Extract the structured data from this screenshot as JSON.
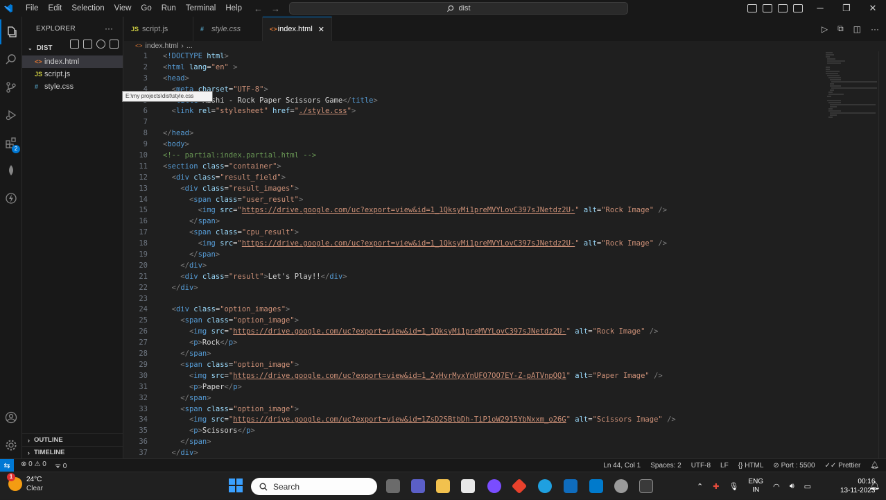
{
  "menu": [
    "File",
    "Edit",
    "Selection",
    "View",
    "Go",
    "Run",
    "Terminal",
    "Help"
  ],
  "command_center": "dist",
  "explorer": {
    "title": "EXPLORER",
    "folder": "DIST",
    "files": [
      {
        "name": "index.html",
        "type": "html"
      },
      {
        "name": "script.js",
        "type": "js"
      },
      {
        "name": "style.css",
        "type": "css"
      }
    ],
    "outline": "OUTLINE",
    "timeline": "TIMELINE"
  },
  "tooltip": "E:\\my projects\\dist\\style.css",
  "tabs": [
    {
      "label": "script.js",
      "icon": "JS",
      "active": false
    },
    {
      "label": "style.css",
      "icon": "#",
      "active": false
    },
    {
      "label": "index.html",
      "icon": "<>",
      "active": true
    }
  ],
  "breadcrumb": {
    "file": "index.html",
    "rest": "..."
  },
  "code_lines": [
    {
      "n": "1",
      "html": "<span class='br'>&lt;</span><span class='kw'>!DOCTYPE</span> <span class='at'>html</span><span class='br'>&gt;</span>"
    },
    {
      "n": "2",
      "html": "<span class='br'>&lt;</span><span class='kw'>html</span> <span class='at'>lang</span>=<span class='st'>\"en\"</span> <span class='br'>&gt;</span>"
    },
    {
      "n": "3",
      "html": "<span class='br'>&lt;</span><span class='kw'>head</span><span class='br'>&gt;</span>"
    },
    {
      "n": "4",
      "html": "  <span class='br'>&lt;</span><span class='kw'>meta</span> <span class='at'>charset</span>=<span class='st'>\"UTF-8\"</span><span class='br'>&gt;</span>"
    },
    {
      "n": "5",
      "html": "  <span class='br'>&lt;</span><span class='kw'>title</span><span class='br'>&gt;</span><span class='tx'>Rishi - Rock Paper Scissors Game</span><span class='br'>&lt;/</span><span class='kw'>title</span><span class='br'>&gt;</span>"
    },
    {
      "n": "6",
      "html": "  <span class='br'>&lt;</span><span class='kw'>link</span> <span class='at'>rel</span>=<span class='st'>\"stylesheet\"</span> <span class='at'>href</span>=<span class='st'>\"<span class='u'>./style.css</span>\"</span><span class='br'>&gt;</span>"
    },
    {
      "n": "7",
      "html": ""
    },
    {
      "n": "8",
      "html": "<span class='br'>&lt;/</span><span class='kw'>head</span><span class='br'>&gt;</span>"
    },
    {
      "n": "9",
      "html": "<span class='br'>&lt;</span><span class='kw'>body</span><span class='br'>&gt;</span>"
    },
    {
      "n": "10",
      "html": "<span class='cm'>&lt;!-- partial:index.partial.html --&gt;</span>"
    },
    {
      "n": "11",
      "html": "<span class='br'>&lt;</span><span class='kw'>section</span> <span class='at'>class</span>=<span class='st'>\"container\"</span><span class='br'>&gt;</span>"
    },
    {
      "n": "12",
      "html": "  <span class='br'>&lt;</span><span class='kw'>div</span> <span class='at'>class</span>=<span class='st'>\"result_field\"</span><span class='br'>&gt;</span>"
    },
    {
      "n": "13",
      "html": "    <span class='br'>&lt;</span><span class='kw'>div</span> <span class='at'>class</span>=<span class='st'>\"result_images\"</span><span class='br'>&gt;</span>"
    },
    {
      "n": "14",
      "html": "      <span class='br'>&lt;</span><span class='kw'>span</span> <span class='at'>class</span>=<span class='st'>\"user_result\"</span><span class='br'>&gt;</span>"
    },
    {
      "n": "15",
      "html": "        <span class='br'>&lt;</span><span class='kw'>img</span> <span class='at'>src</span>=<span class='st'>\"<span class='u'>https://drive.google.com/uc?export=view&amp;id=1_1QksyMi1preMVYLovC397sJNetdz2U-</span>\"</span> <span class='at'>alt</span>=<span class='st'>\"Rock Image\"</span> <span class='br'>/&gt;</span>"
    },
    {
      "n": "16",
      "html": "      <span class='br'>&lt;/</span><span class='kw'>span</span><span class='br'>&gt;</span>"
    },
    {
      "n": "17",
      "html": "      <span class='br'>&lt;</span><span class='kw'>span</span> <span class='at'>class</span>=<span class='st'>\"cpu_result\"</span><span class='br'>&gt;</span>"
    },
    {
      "n": "18",
      "html": "        <span class='br'>&lt;</span><span class='kw'>img</span> <span class='at'>src</span>=<span class='st'>\"<span class='u'>https://drive.google.com/uc?export=view&amp;id=1_1QksyMi1preMVYLovC397sJNetdz2U-</span>\"</span> <span class='at'>alt</span>=<span class='st'>\"Rock Image\"</span> <span class='br'>/&gt;</span>"
    },
    {
      "n": "19",
      "html": "      <span class='br'>&lt;/</span><span class='kw'>span</span><span class='br'>&gt;</span>"
    },
    {
      "n": "20",
      "html": "    <span class='br'>&lt;/</span><span class='kw'>div</span><span class='br'>&gt;</span>"
    },
    {
      "n": "21",
      "html": "    <span class='br'>&lt;</span><span class='kw'>div</span> <span class='at'>class</span>=<span class='st'>\"result\"</span><span class='br'>&gt;</span><span class='tx'>Let's Play!!</span><span class='br'>&lt;/</span><span class='kw'>div</span><span class='br'>&gt;</span>"
    },
    {
      "n": "22",
      "html": "  <span class='br'>&lt;/</span><span class='kw'>div</span><span class='br'>&gt;</span>"
    },
    {
      "n": "23",
      "html": ""
    },
    {
      "n": "24",
      "html": "  <span class='br'>&lt;</span><span class='kw'>div</span> <span class='at'>class</span>=<span class='st'>\"option_images\"</span><span class='br'>&gt;</span>"
    },
    {
      "n": "25",
      "html": "    <span class='br'>&lt;</span><span class='kw'>span</span> <span class='at'>class</span>=<span class='st'>\"option_image\"</span><span class='br'>&gt;</span>"
    },
    {
      "n": "26",
      "html": "      <span class='br'>&lt;</span><span class='kw'>img</span> <span class='at'>src</span>=<span class='st'>\"<span class='u'>https://drive.google.com/uc?export=view&amp;id=1_1QksyMi1preMVYLovC397sJNetdz2U-</span>\"</span> <span class='at'>alt</span>=<span class='st'>\"Rock Image\"</span> <span class='br'>/&gt;</span>"
    },
    {
      "n": "27",
      "html": "      <span class='br'>&lt;</span><span class='kw'>p</span><span class='br'>&gt;</span><span class='tx'>Rock</span><span class='br'>&lt;/</span><span class='kw'>p</span><span class='br'>&gt;</span>"
    },
    {
      "n": "28",
      "html": "    <span class='br'>&lt;/</span><span class='kw'>span</span><span class='br'>&gt;</span>"
    },
    {
      "n": "29",
      "html": "    <span class='br'>&lt;</span><span class='kw'>span</span> <span class='at'>class</span>=<span class='st'>\"option_image\"</span><span class='br'>&gt;</span>"
    },
    {
      "n": "30",
      "html": "      <span class='br'>&lt;</span><span class='kw'>img</span> <span class='at'>src</span>=<span class='st'>\"<span class='u'>https://drive.google.com/uc?export=view&amp;id=1_2yHvrMyxYnUFO7OO7EY-Z-pATVnpQQ1</span>\"</span> <span class='at'>alt</span>=<span class='st'>\"Paper Image\"</span> <span class='br'>/&gt;</span>"
    },
    {
      "n": "31",
      "html": "      <span class='br'>&lt;</span><span class='kw'>p</span><span class='br'>&gt;</span><span class='tx'>Paper</span><span class='br'>&lt;/</span><span class='kw'>p</span><span class='br'>&gt;</span>"
    },
    {
      "n": "32",
      "html": "    <span class='br'>&lt;/</span><span class='kw'>span</span><span class='br'>&gt;</span>"
    },
    {
      "n": "33",
      "html": "    <span class='br'>&lt;</span><span class='kw'>span</span> <span class='at'>class</span>=<span class='st'>\"option_image\"</span><span class='br'>&gt;</span>"
    },
    {
      "n": "34",
      "html": "      <span class='br'>&lt;</span><span class='kw'>img</span> <span class='at'>src</span>=<span class='st'>\"<span class='u'>https://drive.google.com/uc?export=view&amp;id=1ZsD2SBtbDh-TiP1oW2915YbNxxm_o26G</span>\"</span> <span class='at'>alt</span>=<span class='st'>\"Scissors Image\"</span> <span class='br'>/&gt;</span>"
    },
    {
      "n": "35",
      "html": "      <span class='br'>&lt;</span><span class='kw'>p</span><span class='br'>&gt;</span><span class='tx'>Scissors</span><span class='br'>&lt;/</span><span class='kw'>p</span><span class='br'>&gt;</span>"
    },
    {
      "n": "36",
      "html": "    <span class='br'>&lt;/</span><span class='kw'>span</span><span class='br'>&gt;</span>"
    },
    {
      "n": "37",
      "html": "  <span class='br'>&lt;/</span><span class='kw'>div</span><span class='br'>&gt;</span>"
    }
  ],
  "statusbar": {
    "errors": "0",
    "warnings": "0",
    "ports": "0",
    "cursor": "Ln 44, Col 1",
    "spaces": "Spaces: 2",
    "encoding": "UTF-8",
    "eol": "LF",
    "language": "HTML",
    "port": "Port : 5500",
    "formatter": "Prettier"
  },
  "taskbar": {
    "temperature": "24°C",
    "condition": "Clear",
    "weather_badge": "1",
    "search_placeholder": "Search",
    "lang_top": "ENG",
    "lang_bottom": "IN",
    "time": "00:16",
    "date": "13-11-2023"
  },
  "activity_badge": "2",
  "colors": {
    "accent": "#0078d4",
    "editor_bg": "#1f1f1f",
    "chrome_bg": "#181818"
  }
}
